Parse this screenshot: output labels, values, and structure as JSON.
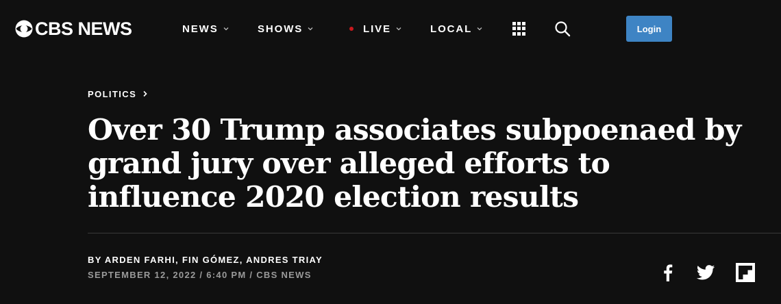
{
  "header": {
    "logo_text": "CBS NEWS",
    "nav": [
      {
        "label": "NEWS"
      },
      {
        "label": "SHOWS"
      },
      {
        "label": "LIVE"
      },
      {
        "label": "LOCAL"
      }
    ],
    "login_label": "Login",
    "icons": [
      "cbs-eye-logo-icon",
      "chevron-down-icon",
      "live-dot-icon",
      "grid-menu-icon",
      "search-icon"
    ]
  },
  "article": {
    "category": "POLITICS",
    "headline": "Over 30 Trump associates subpoenaed by grand jury over alleged efforts to influence 2020 election results",
    "byline": "BY ARDEN FARHI, FIN GÓMEZ, ANDRES TRIAY",
    "dateline": "SEPTEMBER 12, 2022 / 6:40 PM / CBS NEWS"
  },
  "share": {
    "icons": [
      "facebook-icon",
      "twitter-icon",
      "flipboard-icon"
    ]
  },
  "colors": {
    "background": "#101010",
    "accent_login": "#3e84c4",
    "live_dot": "#c9191e",
    "dateline_text": "#9a9a9a",
    "divider": "#3a3a3a"
  }
}
